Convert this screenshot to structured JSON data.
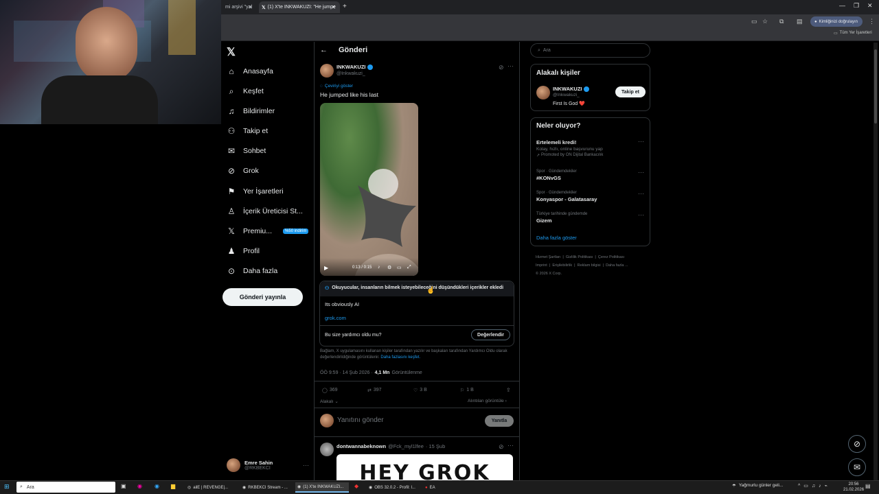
{
  "browser": {
    "tabs": [
      {
        "label": "mi arşivi \"yal"
      },
      {
        "label": "(1) X'te INKWAKUZI: \"He jumpe"
      }
    ],
    "new_tab": "+",
    "profile_label": "Kimliğinizi doğrulayın",
    "bookmarks_label": "Tüm Yer İşaretleri"
  },
  "nav": {
    "items": [
      {
        "label": "Anasayfa",
        "icon": "home-icon"
      },
      {
        "label": "Keşfet",
        "icon": "search-icon"
      },
      {
        "label": "Bildirimler",
        "icon": "bell-icon"
      },
      {
        "label": "Takip et",
        "icon": "follow-icon"
      },
      {
        "label": "Sohbet",
        "icon": "mail-icon"
      },
      {
        "label": "Grok",
        "icon": "grok-icon"
      },
      {
        "label": "Yer İşaretleri",
        "icon": "bookmark-icon"
      },
      {
        "label": "İçerik Üreticisi St...",
        "icon": "creator-icon"
      },
      {
        "label": "Premiu...",
        "icon": "x-icon"
      },
      {
        "label": "Profil",
        "icon": "profile-icon"
      },
      {
        "label": "Daha fazla",
        "icon": "more-icon"
      }
    ],
    "premium_badge": "%50 indirim",
    "post_button": "Gönderi yayınla",
    "user": {
      "name": "Emre Sahin",
      "handle": "@RKBEKCI"
    }
  },
  "post": {
    "header_title": "Gönderi",
    "author_name": "INKWAKUZI",
    "author_handle": "@Inkwakuzi_",
    "translate": "Çeviriyi göster",
    "text": "He jumped like his last",
    "video_time": "0:13 / 0:15",
    "note_title": "Okuyucular, insanların bilmek isteyebileceğini düşündükleri içerikler ekledi",
    "note_text": "Its obviously AI",
    "note_link": "grok.com",
    "helpful_q": "Bu size yardımcı oldu mu?",
    "rate_button": "Değerlendir",
    "disclaimer": "Bağlam, X uygulamasını kullanan kişiler tarafından yazılır ve başkaları tarafından Yardımcı Oldu olarak değerlendirildiğinde görüntülenir.",
    "disclaimer_link": "Daha fazlasını keşfet.",
    "timestamp": "ÖÖ 9:59 · 14 Şub 2026 ·",
    "views_count": "4,1 Mn",
    "views_label": "Görüntülenme",
    "replies": "369",
    "reposts": "397",
    "likes": "3 B",
    "bookmarks": "1 B",
    "sort": "Alakalı",
    "quotes": "Alıntıları görüntüle",
    "reply_placeholder": "Yanıtını gönder",
    "reply_button": "Yanıtla",
    "next_reply": {
      "name": "dontwannabeknown",
      "handle": "@Fck_myl1lfee",
      "date": "· 15 Şub",
      "image_text": "HEY GROK"
    }
  },
  "right": {
    "search_placeholder": "Ara",
    "related_title": "Alakalı kişiler",
    "related": {
      "name": "INKWAKUZI",
      "handle": "@Inkwakuzi_",
      "bio": "First Is God ❤️",
      "follow": "Takip et"
    },
    "trends_title": "Neler oluyor?",
    "trends": [
      {
        "meta": "",
        "title": "Ertelemeli kredi!",
        "sub": "Kolay, hızlı, online başvurunu yap",
        "promo": "Promoted by ON Dijital Bankacılık"
      },
      {
        "meta": "Spor · Gündemdekiler",
        "title": "#KONvGS",
        "sub": "",
        "promo": ""
      },
      {
        "meta": "Spor · Gündemdekiler",
        "title": "Konyaspor - Galatasaray",
        "sub": "",
        "promo": ""
      },
      {
        "meta": "Türkiye tarihinde gündemde",
        "title": "Gizem",
        "sub": "",
        "promo": ""
      }
    ],
    "show_more": "Daha fazla göster",
    "footer": [
      "Hizmet Şartları",
      "Gizlilik Politikası",
      "Çerez Politikası",
      "Imprint",
      "Erişilebilirlik",
      "Reklam bilgisi",
      "Daha fazla ...",
      "© 2026 X Corp."
    ]
  },
  "taskbar": {
    "search": "Ara",
    "apps": [
      {
        "label": "ailE | REVENGE|..."
      },
      {
        "label": "RKBEKCI Stream - ..."
      },
      {
        "label": "(1) X'te INKWAKUZI..."
      },
      {
        "label": "OBS 32.0.2 - Profil: l..."
      },
      {
        "label": "EA"
      }
    ],
    "weather": "Yağmurlu günler geli...",
    "time": "20:56",
    "date": "21.02.2026"
  }
}
